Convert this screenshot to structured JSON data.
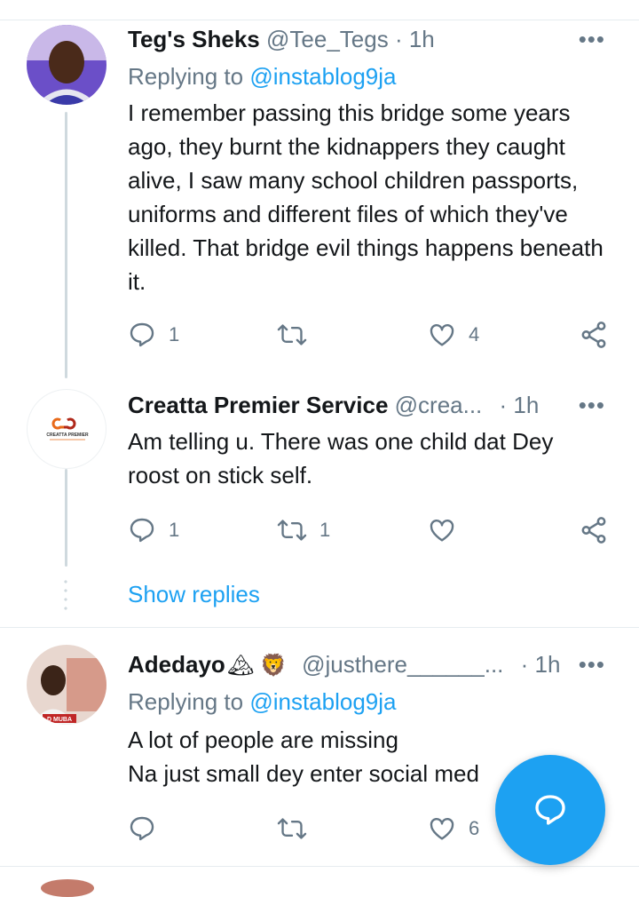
{
  "tweets": [
    {
      "display_name": "Teg's Sheks",
      "handle": "@Tee_Tegs",
      "time": "· 1h",
      "replying_prefix": "Replying to ",
      "replying_handle": "@instablog9ja",
      "text": "I remember passing this bridge some years ago, they burnt the kidnappers they caught alive, I saw many school children passports, uniforms and different files of which they've killed. That bridge evil things happens beneath it.",
      "reply_count": "1",
      "retweet_count": "",
      "like_count": "4"
    },
    {
      "display_name": "Creatta Premier Service",
      "handle": "@crea...",
      "time": "· 1h",
      "text": "Am telling u. There was one child dat Dey roost on stick self.",
      "reply_count": "1",
      "retweet_count": "1",
      "like_count": "",
      "avatar_logo": "CREATTA PREMIER"
    },
    {
      "display_name": "Adedayo",
      "name_emojis": "🏔 🦁",
      "handle": "@justhere______...",
      "time": "· 1h",
      "replying_prefix": "Replying to ",
      "replying_handle": "@instablog9ja",
      "text_line1": "A lot of people are missing",
      "text_line2": "Na just small dey enter social med",
      "reply_count": "",
      "retweet_count": "",
      "like_count": "6",
      "avatar_badge": "D MUBA"
    }
  ],
  "show_replies": "Show replies",
  "more_glyph": "•••",
  "colors": {
    "accent": "#1da1f2",
    "muted": "#657786",
    "divider": "#e6ecf0"
  },
  "icons": [
    "reply-icon",
    "retweet-icon",
    "like-icon",
    "share-icon",
    "more-icon",
    "compose-reply-icon"
  ]
}
